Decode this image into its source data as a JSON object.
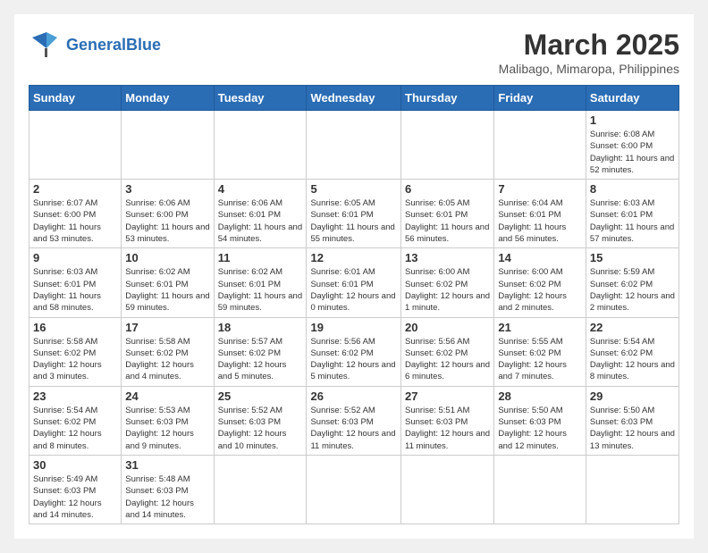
{
  "header": {
    "logo_general": "General",
    "logo_blue": "Blue",
    "month": "March 2025",
    "location": "Malibago, Mimaropa, Philippines"
  },
  "weekdays": [
    "Sunday",
    "Monday",
    "Tuesday",
    "Wednesday",
    "Thursday",
    "Friday",
    "Saturday"
  ],
  "weeks": [
    [
      {
        "day": "",
        "info": ""
      },
      {
        "day": "",
        "info": ""
      },
      {
        "day": "",
        "info": ""
      },
      {
        "day": "",
        "info": ""
      },
      {
        "day": "",
        "info": ""
      },
      {
        "day": "",
        "info": ""
      },
      {
        "day": "1",
        "info": "Sunrise: 6:08 AM\nSunset: 6:00 PM\nDaylight: 11 hours and 52 minutes."
      }
    ],
    [
      {
        "day": "2",
        "info": "Sunrise: 6:07 AM\nSunset: 6:00 PM\nDaylight: 11 hours and 53 minutes."
      },
      {
        "day": "3",
        "info": "Sunrise: 6:06 AM\nSunset: 6:00 PM\nDaylight: 11 hours and 53 minutes."
      },
      {
        "day": "4",
        "info": "Sunrise: 6:06 AM\nSunset: 6:01 PM\nDaylight: 11 hours and 54 minutes."
      },
      {
        "day": "5",
        "info": "Sunrise: 6:05 AM\nSunset: 6:01 PM\nDaylight: 11 hours and 55 minutes."
      },
      {
        "day": "6",
        "info": "Sunrise: 6:05 AM\nSunset: 6:01 PM\nDaylight: 11 hours and 56 minutes."
      },
      {
        "day": "7",
        "info": "Sunrise: 6:04 AM\nSunset: 6:01 PM\nDaylight: 11 hours and 56 minutes."
      },
      {
        "day": "8",
        "info": "Sunrise: 6:03 AM\nSunset: 6:01 PM\nDaylight: 11 hours and 57 minutes."
      }
    ],
    [
      {
        "day": "9",
        "info": "Sunrise: 6:03 AM\nSunset: 6:01 PM\nDaylight: 11 hours and 58 minutes."
      },
      {
        "day": "10",
        "info": "Sunrise: 6:02 AM\nSunset: 6:01 PM\nDaylight: 11 hours and 59 minutes."
      },
      {
        "day": "11",
        "info": "Sunrise: 6:02 AM\nSunset: 6:01 PM\nDaylight: 11 hours and 59 minutes."
      },
      {
        "day": "12",
        "info": "Sunrise: 6:01 AM\nSunset: 6:01 PM\nDaylight: 12 hours and 0 minutes."
      },
      {
        "day": "13",
        "info": "Sunrise: 6:00 AM\nSunset: 6:02 PM\nDaylight: 12 hours and 1 minute."
      },
      {
        "day": "14",
        "info": "Sunrise: 6:00 AM\nSunset: 6:02 PM\nDaylight: 12 hours and 2 minutes."
      },
      {
        "day": "15",
        "info": "Sunrise: 5:59 AM\nSunset: 6:02 PM\nDaylight: 12 hours and 2 minutes."
      }
    ],
    [
      {
        "day": "16",
        "info": "Sunrise: 5:58 AM\nSunset: 6:02 PM\nDaylight: 12 hours and 3 minutes."
      },
      {
        "day": "17",
        "info": "Sunrise: 5:58 AM\nSunset: 6:02 PM\nDaylight: 12 hours and 4 minutes."
      },
      {
        "day": "18",
        "info": "Sunrise: 5:57 AM\nSunset: 6:02 PM\nDaylight: 12 hours and 5 minutes."
      },
      {
        "day": "19",
        "info": "Sunrise: 5:56 AM\nSunset: 6:02 PM\nDaylight: 12 hours and 5 minutes."
      },
      {
        "day": "20",
        "info": "Sunrise: 5:56 AM\nSunset: 6:02 PM\nDaylight: 12 hours and 6 minutes."
      },
      {
        "day": "21",
        "info": "Sunrise: 5:55 AM\nSunset: 6:02 PM\nDaylight: 12 hours and 7 minutes."
      },
      {
        "day": "22",
        "info": "Sunrise: 5:54 AM\nSunset: 6:02 PM\nDaylight: 12 hours and 8 minutes."
      }
    ],
    [
      {
        "day": "23",
        "info": "Sunrise: 5:54 AM\nSunset: 6:02 PM\nDaylight: 12 hours and 8 minutes."
      },
      {
        "day": "24",
        "info": "Sunrise: 5:53 AM\nSunset: 6:03 PM\nDaylight: 12 hours and 9 minutes."
      },
      {
        "day": "25",
        "info": "Sunrise: 5:52 AM\nSunset: 6:03 PM\nDaylight: 12 hours and 10 minutes."
      },
      {
        "day": "26",
        "info": "Sunrise: 5:52 AM\nSunset: 6:03 PM\nDaylight: 12 hours and 11 minutes."
      },
      {
        "day": "27",
        "info": "Sunrise: 5:51 AM\nSunset: 6:03 PM\nDaylight: 12 hours and 11 minutes."
      },
      {
        "day": "28",
        "info": "Sunrise: 5:50 AM\nSunset: 6:03 PM\nDaylight: 12 hours and 12 minutes."
      },
      {
        "day": "29",
        "info": "Sunrise: 5:50 AM\nSunset: 6:03 PM\nDaylight: 12 hours and 13 minutes."
      }
    ],
    [
      {
        "day": "30",
        "info": "Sunrise: 5:49 AM\nSunset: 6:03 PM\nDaylight: 12 hours and 14 minutes."
      },
      {
        "day": "31",
        "info": "Sunrise: 5:48 AM\nSunset: 6:03 PM\nDaylight: 12 hours and 14 minutes."
      },
      {
        "day": "",
        "info": ""
      },
      {
        "day": "",
        "info": ""
      },
      {
        "day": "",
        "info": ""
      },
      {
        "day": "",
        "info": ""
      },
      {
        "day": "",
        "info": ""
      }
    ]
  ]
}
